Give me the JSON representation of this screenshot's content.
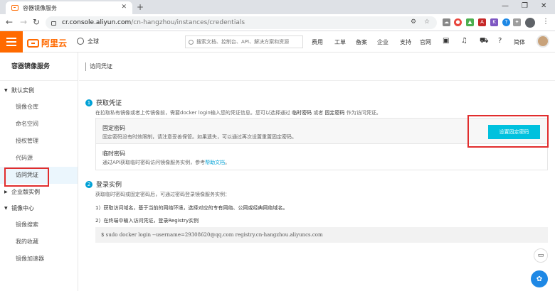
{
  "browser": {
    "tab_title": "容器镜像服务",
    "url_host": "cr.console.aliyun.com",
    "url_path": "/cn-hangzhou/instances/credentials"
  },
  "topbar": {
    "brand": "阿里云",
    "region": "全球",
    "search_placeholder": "搜索文档、控制台、API、解决方案和资源",
    "nav": [
      "费用",
      "工单",
      "备案",
      "企业",
      "支持",
      "官网"
    ],
    "lang": "简体",
    "accent": "#ff6a00"
  },
  "sidebar": {
    "title": "容器镜像服务",
    "groups": [
      {
        "label": "默认实例",
        "items": [
          "镜像仓库",
          "命名空间",
          "授权管理",
          "代码源",
          "访问凭证"
        ]
      },
      {
        "label": "企业版实例",
        "items": []
      },
      {
        "label": "镜像中心",
        "items": [
          "镜像搜索",
          "我的收藏",
          "镜像加速器"
        ]
      }
    ],
    "active_item": "访问凭证"
  },
  "main": {
    "page_title": "访问凭证",
    "step1": {
      "num": "1",
      "title": "获取凭证",
      "desc_pre": "在拉取私有镜像或者上传镜像前，需要docker login输入您的凭证信息。您可以选择通过",
      "desc_b1": "临时密码",
      "desc_mid": "或者",
      "desc_b2": "固定密码",
      "desc_post": "作为访问凭证。"
    },
    "fixed": {
      "title": "固定密码",
      "desc": "固定密码没有时效限制，请注意妥善保管。如果遗失，可以通过再次设置重置固定密码。",
      "button": "设置固定密码"
    },
    "temp": {
      "title": "临时密码",
      "desc_pre": "通过API获取临时密码访问镜像服务实例，参考",
      "link": "帮助文档",
      "desc_post": "。"
    },
    "step2": {
      "num": "2",
      "title": "登录实例",
      "desc": "获取临时密码或固定密码后，可通过密码登录镜像服务实例：",
      "line1": "1）获取访问域名，基于当前的网络环境，选择对应的专有网络、公网或经典网络域名。",
      "line2": "2）在终端中输入访问凭证，登录Registry实例",
      "command": "$ sudo docker login --username=29308620@qq.com registry.cn-hangzhou.aliyuncs.com"
    }
  }
}
